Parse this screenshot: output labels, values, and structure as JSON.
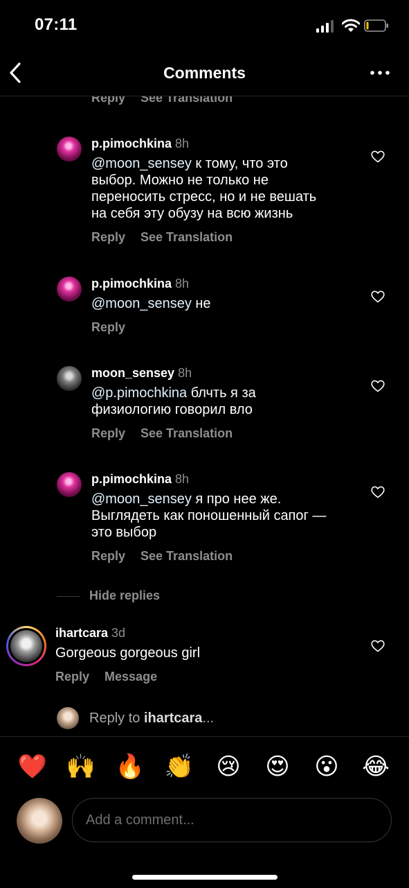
{
  "status_bar": {
    "time": "07:11"
  },
  "header": {
    "title": "Comments"
  },
  "partial_top": {
    "reply": "Reply",
    "see_translation": "See Translation"
  },
  "comments": [
    {
      "username": "p.pimochkina",
      "time": "8h",
      "mention": "@moon_sensey",
      "text": " к тому, что это\nвыбор. Можно не только не\nпереносить стресс, но и не вешать\nна себя эту обузу на всю жизнь",
      "reply": "Reply",
      "see_translation": "See Translation"
    },
    {
      "username": "p.pimochkina",
      "time": "8h",
      "mention": "@moon_sensey",
      "text": " не",
      "reply": "Reply"
    },
    {
      "username": "moon_sensey",
      "time": "8h",
      "mention": "@p.pimochkina",
      "text": " блчть я за\nфизиологию говорил вло",
      "reply": "Reply",
      "see_translation": "See Translation"
    },
    {
      "username": "p.pimochkina",
      "time": "8h",
      "mention": "@moon_sensey",
      "text": " я про нее же.\nВыглядеть как поношенный сапог —\nэто выбор",
      "reply": "Reply",
      "see_translation": "See Translation"
    }
  ],
  "hide_replies": "Hide replies",
  "top_comment": {
    "username": "ihartcara",
    "time": "3d",
    "text": "Gorgeous gorgeous girl",
    "reply": "Reply",
    "message": "Message"
  },
  "reply_to": {
    "prefix": "Reply to ",
    "username": "ihartcara",
    "suffix": "..."
  },
  "emoji_bar": [
    "❤️",
    "🙌",
    "🔥",
    "👏",
    "😢",
    "😍",
    "😮",
    "😂"
  ],
  "composer": {
    "placeholder": "Add a comment..."
  },
  "colors": {
    "background": "#000000",
    "secondary_text": "#8e8e8e",
    "mention": "#e0f1ff",
    "emoji_heart": "#ed1c24"
  }
}
